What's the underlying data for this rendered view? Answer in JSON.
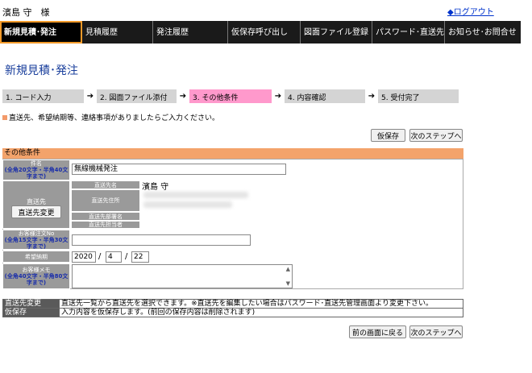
{
  "header": {
    "user": "濱島 守　様",
    "logout": "◆ログアウト"
  },
  "nav": [
    "新規見積･発注",
    "見積履歴",
    "発注履歴",
    "仮保存呼び出し",
    "図面ファイル登録",
    "パスワード･直送先",
    "お知らせ･お問合せ"
  ],
  "page_title": "新規見積･発注",
  "steps": [
    "1. コード入力",
    "2. 図面ファイル添付",
    "3. その他条件",
    "4. 内容確認",
    "5. 受付完了"
  ],
  "notice": "直送先、希望納期等、連絡事項がありましたらご入力ください。",
  "buttons": {
    "temp_save": "仮保存",
    "next_step": "次のステップへ",
    "prev_page": "前の画面に戻る",
    "change_dest": "直送先変更"
  },
  "section_title": "その他条件",
  "form": {
    "subject_label": "件名",
    "subject_hint": "(全角20文字・半角40文字まで)",
    "subject_value": "無線機械発注",
    "dest_label": "直送先",
    "dest_name_label": "直送先名",
    "dest_name_value": "濱島 守",
    "dest_addr_label": "直送先住所",
    "dest_dept_label": "直送先部署名",
    "dest_person_label": "直送先担当者",
    "order_no_label": "お客様注文No",
    "order_no_hint": "(全角15文字・半角30文字まで)",
    "date_label": "希望納期",
    "date_year": "2020",
    "date_month": "4",
    "date_day": "22",
    "memo_label": "お客様メモ",
    "memo_hint": "(全角40文字・半角80文字まで)"
  },
  "info": [
    {
      "key": "直送先変更",
      "value": "直送先一覧から直送先を選択できます。※直送先を編集したい場合はパスワード･直送先管理画面より変更下さい。"
    },
    {
      "key": "仮保存",
      "value": "入力内容を仮保存します。(前回の保存内容は削除されます)"
    }
  ]
}
